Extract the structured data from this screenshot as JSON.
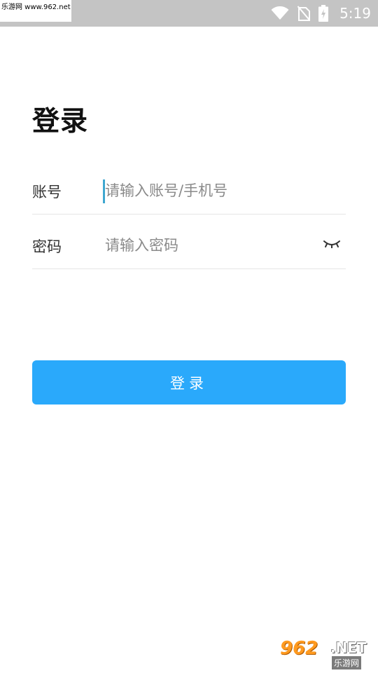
{
  "status_bar": {
    "watermark": "乐游网 www.962.net",
    "time": "5:19",
    "icons": [
      "wifi-icon",
      "no-sim-icon",
      "battery-charging-icon"
    ]
  },
  "page": {
    "title": "登录"
  },
  "form": {
    "account": {
      "label": "账号",
      "placeholder": "请输入账号/手机号",
      "value": ""
    },
    "password": {
      "label": "密码",
      "placeholder": "请输入密码",
      "value": "",
      "toggle_icon": "eye-closed-icon"
    },
    "login_button": "登录"
  },
  "watermark": {
    "number": "962",
    "domain": ".NET",
    "name": "乐游网"
  },
  "colors": {
    "accent": "#2aa9fb",
    "status_bar": "#c4c4c4",
    "caret": "#3fa7d0"
  }
}
